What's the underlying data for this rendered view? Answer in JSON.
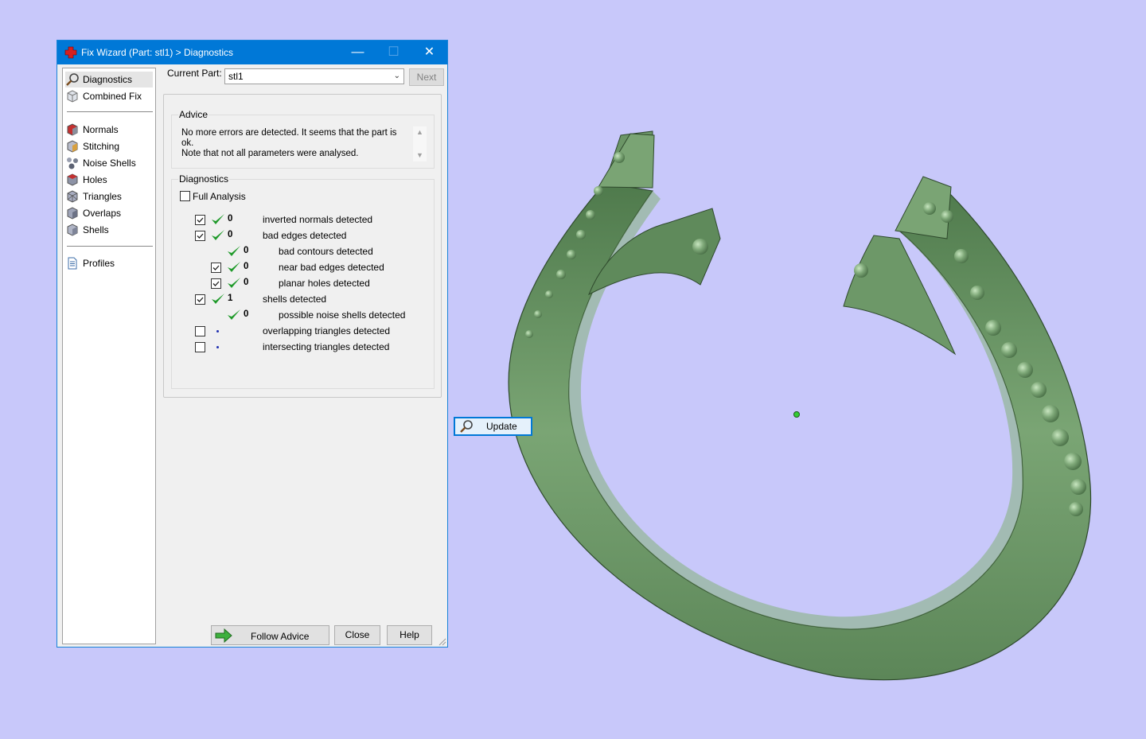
{
  "window": {
    "title": "Fix Wizard (Part: stl1) > Diagnostics"
  },
  "nav": {
    "items": [
      {
        "label": "Diagnostics",
        "icon": "magnifier-icon"
      },
      {
        "label": "Combined Fix",
        "icon": "combined-fix-icon"
      },
      {
        "label": "Normals",
        "icon": "normals-cube-icon"
      },
      {
        "label": "Stitching",
        "icon": "stitching-cube-icon"
      },
      {
        "label": "Noise Shells",
        "icon": "noise-shells-icon"
      },
      {
        "label": "Holes",
        "icon": "holes-cube-icon"
      },
      {
        "label": "Triangles",
        "icon": "triangles-cube-icon"
      },
      {
        "label": "Overlaps",
        "icon": "overlaps-cube-icon"
      },
      {
        "label": "Shells",
        "icon": "shells-cube-icon"
      },
      {
        "label": "Profiles",
        "icon": "profiles-document-icon"
      }
    ],
    "selected": "Diagnostics"
  },
  "header": {
    "current_part_label": "Current Part:",
    "current_part_value": "stl1",
    "next_label": "Next"
  },
  "advice": {
    "title": "Advice",
    "line1": "No more errors are detected. It seems that the part is ok.",
    "line2": "Note that not all parameters were analysed."
  },
  "diagnostics": {
    "title": "Diagnostics",
    "full_analysis_label": "Full Analysis",
    "full_analysis_checked": false,
    "rows": [
      {
        "label": "inverted normals detected",
        "count": "0",
        "checkbox": true,
        "checked": true,
        "status": "ok",
        "indent": 0
      },
      {
        "label": "bad edges detected",
        "count": "0",
        "checkbox": true,
        "checked": true,
        "status": "ok",
        "indent": 0
      },
      {
        "label": "bad contours detected",
        "count": "0",
        "checkbox": false,
        "checked": false,
        "status": "ok",
        "indent": 1
      },
      {
        "label": "near bad edges detected",
        "count": "0",
        "checkbox": true,
        "checked": true,
        "status": "ok",
        "indent": 1
      },
      {
        "label": "planar holes detected",
        "count": "0",
        "checkbox": true,
        "checked": true,
        "status": "ok",
        "indent": 1
      },
      {
        "label": "shells detected",
        "count": "1",
        "checkbox": true,
        "checked": true,
        "status": "ok",
        "indent": 0
      },
      {
        "label": "possible noise shells detected",
        "count": "0",
        "checkbox": false,
        "checked": false,
        "status": "ok",
        "indent": 1
      },
      {
        "label": "overlapping triangles detected",
        "count": "",
        "checkbox": true,
        "checked": false,
        "status": "pending",
        "indent": 0
      },
      {
        "label": "intersecting triangles detected",
        "count": "",
        "checkbox": true,
        "checked": false,
        "status": "pending",
        "indent": 0
      }
    ],
    "update_label": "Update"
  },
  "footer": {
    "follow_advice_label": "Follow Advice",
    "close_label": "Close",
    "help_label": "Help"
  },
  "colors": {
    "background": "#c8c8fa",
    "titlebar": "#0078d7",
    "model_green": "#6f9a6a",
    "check_green": "#1f9a2a"
  }
}
